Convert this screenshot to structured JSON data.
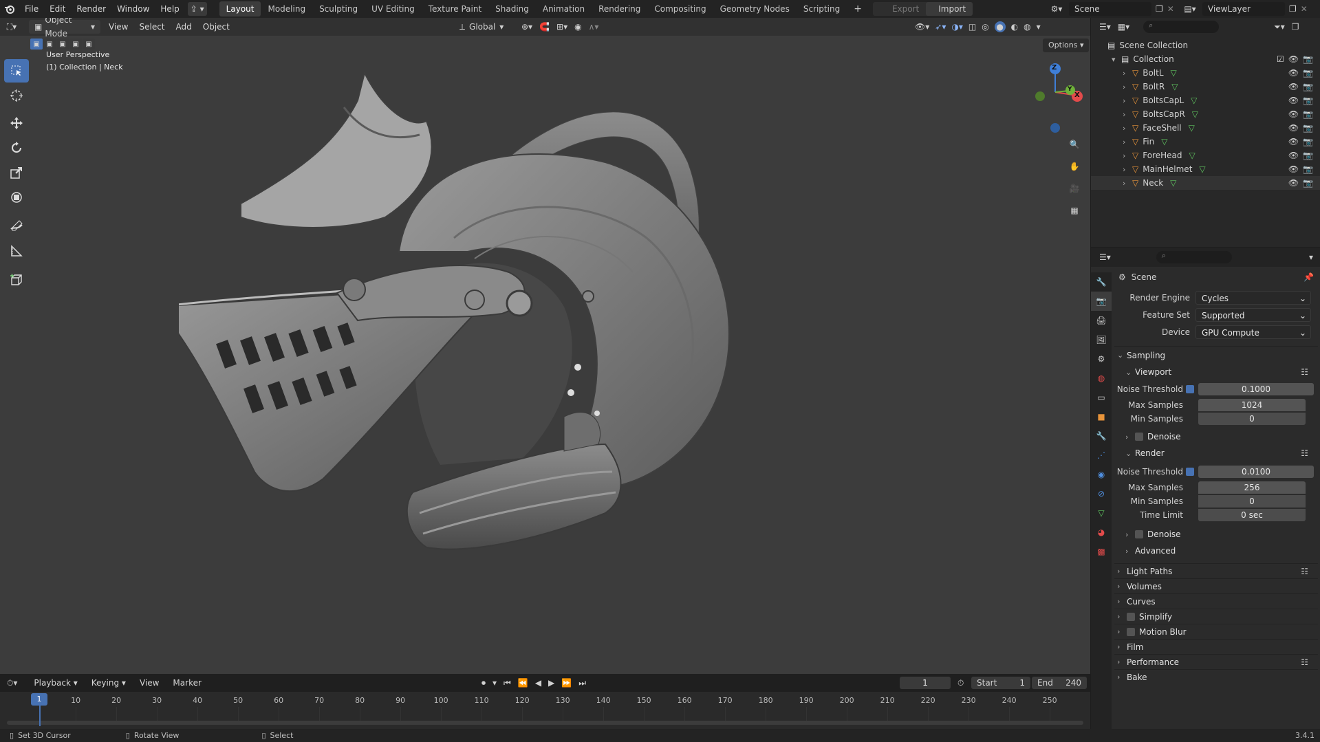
{
  "topbar": {
    "menus": [
      "File",
      "Edit",
      "Render",
      "Window",
      "Help"
    ],
    "workspaces": [
      "Layout",
      "Modeling",
      "Sculpting",
      "UV Editing",
      "Texture Paint",
      "Shading",
      "Animation",
      "Rendering",
      "Compositing",
      "Geometry Nodes",
      "Scripting"
    ],
    "active_workspace": "Layout",
    "export_label": "Export",
    "import_label": "Import",
    "scene_name": "Scene",
    "viewlayer_name": "ViewLayer"
  },
  "viewport": {
    "mode": "Object Mode",
    "menus": [
      "View",
      "Select",
      "Add",
      "Object"
    ],
    "orientation": "Global",
    "options_label": "Options",
    "overlay_line1": "User Perspective",
    "overlay_line2": "(1) Collection | Neck",
    "gizmo": {
      "z": "Z",
      "x": "X",
      "y": "Y"
    }
  },
  "outliner": {
    "root": "Scene Collection",
    "collection": "Collection",
    "objects": [
      "BoltL",
      "BoltR",
      "BoltsCapL",
      "BoltsCapR",
      "FaceShell",
      "Fin",
      "ForeHead",
      "MainHelmet",
      "Neck"
    ],
    "active_object": "Neck"
  },
  "properties": {
    "context": "Scene",
    "render_engine_label": "Render Engine",
    "render_engine": "Cycles",
    "feature_set_label": "Feature Set",
    "feature_set": "Supported",
    "device_label": "Device",
    "device": "GPU Compute",
    "sampling": {
      "title": "Sampling",
      "viewport": {
        "title": "Viewport",
        "noise_threshold_label": "Noise Threshold",
        "noise_threshold": "0.1000",
        "noise_threshold_enabled": true,
        "max_samples_label": "Max Samples",
        "max_samples": "1024",
        "min_samples_label": "Min Samples",
        "min_samples": "0",
        "denoise_label": "Denoise"
      },
      "render": {
        "title": "Render",
        "noise_threshold_label": "Noise Threshold",
        "noise_threshold": "0.0100",
        "noise_threshold_enabled": true,
        "max_samples_label": "Max Samples",
        "max_samples": "256",
        "min_samples_label": "Min Samples",
        "min_samples": "0",
        "time_limit_label": "Time Limit",
        "time_limit": "0 sec",
        "denoise_label": "Denoise"
      },
      "advanced_label": "Advanced"
    },
    "sections": [
      "Light Paths",
      "Volumes",
      "Curves",
      "Simplify",
      "Motion Blur",
      "Film",
      "Performance",
      "Bake"
    ]
  },
  "timeline": {
    "menus": [
      "Playback",
      "Keying",
      "View",
      "Marker"
    ],
    "current_frame": "1",
    "start_label": "Start",
    "start": "1",
    "end_label": "End",
    "end": "240",
    "ticks": [
      "1",
      "10",
      "20",
      "30",
      "40",
      "50",
      "60",
      "70",
      "80",
      "90",
      "100",
      "110",
      "120",
      "130",
      "140",
      "150",
      "160",
      "170",
      "180",
      "190",
      "200",
      "210",
      "220",
      "230",
      "240",
      "250"
    ]
  },
  "statusbar": {
    "hint1": "Set 3D Cursor",
    "hint2": "Rotate View",
    "hint3": "Select",
    "version": "3.4.1"
  },
  "colors": {
    "accent": "#4772b3",
    "viewport_bg": "#3c3c3c",
    "panel_bg": "#2b2b2b",
    "object_icon": "#e8943a",
    "mesh_icon": "#5fc35f",
    "axis_x": "#e34b4b",
    "axis_y": "#6fb23a",
    "axis_z": "#3f7fd8"
  }
}
